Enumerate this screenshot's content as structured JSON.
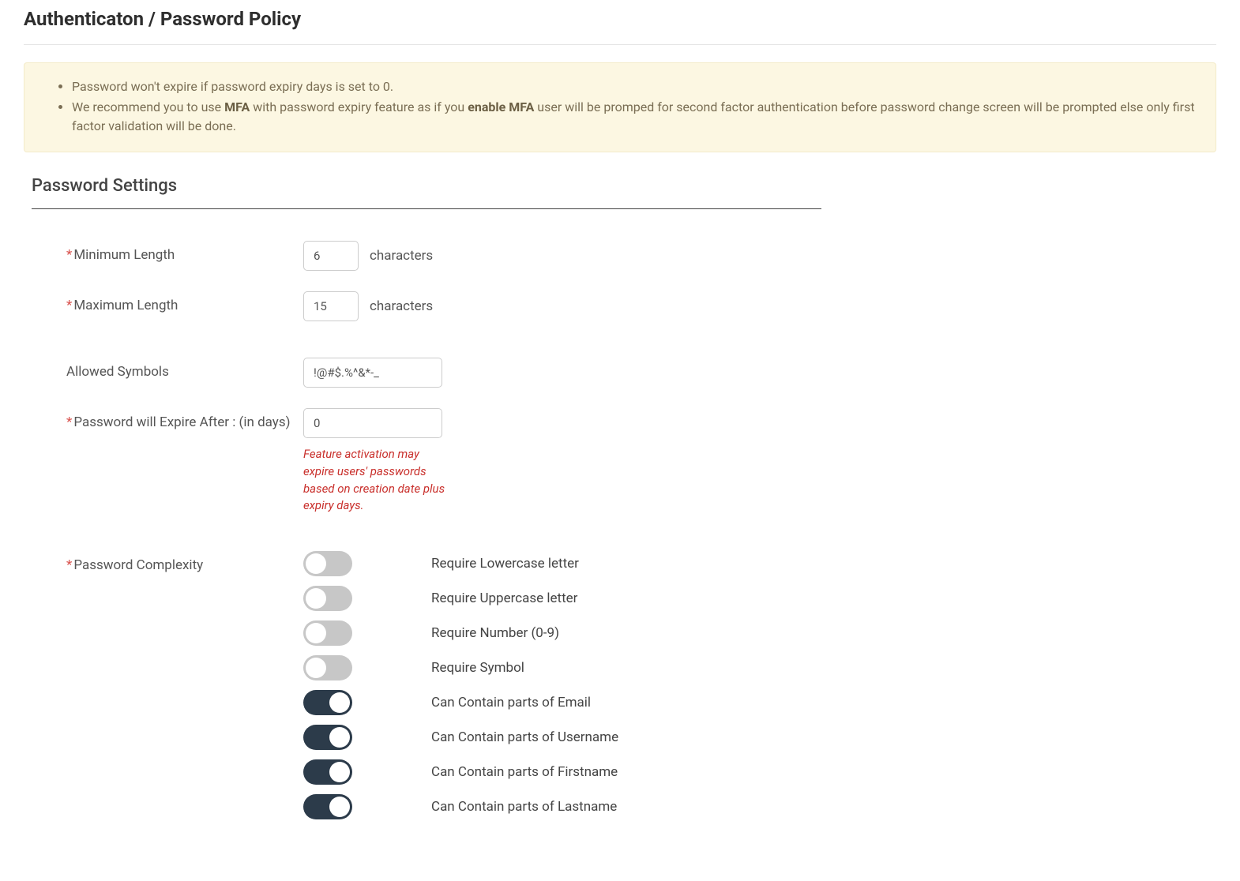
{
  "page": {
    "title": "Authenticaton / Password Policy"
  },
  "alert": {
    "items": [
      {
        "text": "Password won't expire if password expiry days is set to 0."
      },
      {
        "prefix": "We recommend you to use ",
        "bold1": "MFA",
        "mid": " with password expiry feature as if you ",
        "bold2": "enable MFA",
        "suffix": " user will be promped for second factor authentication before password change screen will be prompted else only first factor validation will be done."
      }
    ]
  },
  "section": {
    "title": "Password Settings"
  },
  "fields": {
    "min_length": {
      "label": "Minimum Length",
      "value": "6",
      "suffix": "characters",
      "required": true
    },
    "max_length": {
      "label": "Maximum Length",
      "value": "15",
      "suffix": "characters",
      "required": true
    },
    "allowed_symbols": {
      "label": "Allowed Symbols",
      "value": "!@#$.%^&*-_",
      "required": false
    },
    "expire_after": {
      "label": "Password will Expire After : (in days)",
      "value": "0",
      "required": true,
      "note": "Feature activation may expire users' passwords based on creation date plus expiry days."
    },
    "complexity": {
      "label": "Password Complexity",
      "required": true
    }
  },
  "complexity_toggles": [
    {
      "label": "Require Lowercase letter",
      "on": false,
      "name": "toggle-require-lowercase"
    },
    {
      "label": "Require Uppercase letter",
      "on": false,
      "name": "toggle-require-uppercase"
    },
    {
      "label": "Require Number (0-9)",
      "on": false,
      "name": "toggle-require-number"
    },
    {
      "label": "Require Symbol",
      "on": false,
      "name": "toggle-require-symbol"
    },
    {
      "label": "Can Contain parts of Email",
      "on": true,
      "name": "toggle-contain-email"
    },
    {
      "label": "Can Contain parts of Username",
      "on": true,
      "name": "toggle-contain-username"
    },
    {
      "label": "Can Contain parts of Firstname",
      "on": true,
      "name": "toggle-contain-firstname"
    },
    {
      "label": "Can Contain parts of Lastname",
      "on": true,
      "name": "toggle-contain-lastname"
    }
  ],
  "required_marker": "*"
}
